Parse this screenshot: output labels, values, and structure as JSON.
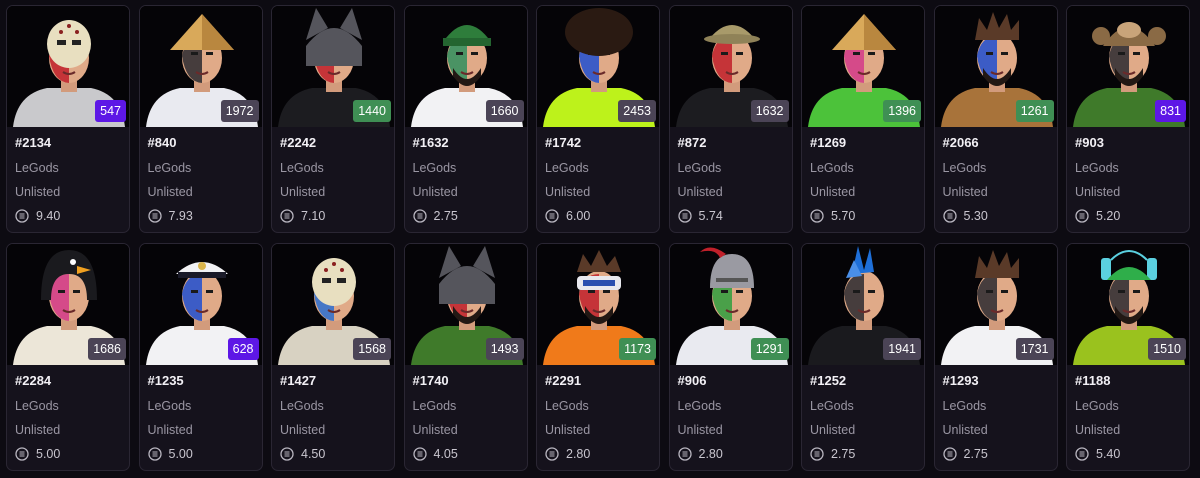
{
  "currency_icon": "solana-coin-icon",
  "rank_colors": {
    "purple": "#5d17e6",
    "gray": "#4b4456",
    "green": "#3f8f54"
  },
  "cards": [
    {
      "token": "#2134",
      "collection": "LeGods",
      "status": "Unlisted",
      "price": "9.40",
      "rank": "547",
      "rank_color": "#5d17e6",
      "outfit": "#c9c9cc",
      "hat": "hockey-mask",
      "hat_color": "#e8dfc0",
      "paint": "#c0202a",
      "has_beard": false
    },
    {
      "token": "#840",
      "collection": "LeGods",
      "status": "Unlisted",
      "price": "7.93",
      "rank": "1972",
      "rank_color": "#4b4456",
      "outfit": "#e9eaf0",
      "hat": "conical-hat",
      "hat_color": "#d9a95a",
      "paint": "#2a2a30",
      "has_beard": false
    },
    {
      "token": "#2242",
      "collection": "LeGods",
      "status": "Unlisted",
      "price": "7.10",
      "rank": "1440",
      "rank_color": "#3f8f54",
      "outfit": "#1c1c20",
      "hat": "wolf-hood",
      "hat_color": "#55555c",
      "paint": "#c0202a",
      "has_beard": false
    },
    {
      "token": "#1632",
      "collection": "LeGods",
      "status": "Unlisted",
      "price": "2.75",
      "rank": "1660",
      "rank_color": "#4b4456",
      "outfit": "#f2f2f4",
      "hat": "beanie",
      "hat_color": "#2e7d3b",
      "paint": "#2f8f5e",
      "has_beard": true
    },
    {
      "token": "#1742",
      "collection": "LeGods",
      "status": "Unlisted",
      "price": "6.00",
      "rank": "2453",
      "rank_color": "#4b4456",
      "outfit": "#bdf21b",
      "hat": "afro",
      "hat_color": "#2a1a12",
      "paint": "#1e4fd1",
      "has_beard": false
    },
    {
      "token": "#872",
      "collection": "LeGods",
      "status": "Unlisted",
      "price": "5.74",
      "rank": "1632",
      "rank_color": "#4b4456",
      "outfit": "#1c1c20",
      "hat": "bucket-hat",
      "hat_color": "#a89a6a",
      "paint": "#c0202a",
      "has_beard": false
    },
    {
      "token": "#1269",
      "collection": "LeGods",
      "status": "Unlisted",
      "price": "5.70",
      "rank": "1396",
      "rank_color": "#3f8f54",
      "outfit": "#4cc23a",
      "hat": "conical-hat",
      "hat_color": "#d9a95a",
      "paint": "#d23a8a",
      "has_beard": false
    },
    {
      "token": "#2066",
      "collection": "LeGods",
      "status": "Unlisted",
      "price": "5.30",
      "rank": "1261",
      "rank_color": "#3f8f54",
      "outfit": "#a8733a",
      "hat": "spiky-hair",
      "hat_color": "#5a3a28",
      "paint": "#1e4fd1",
      "has_beard": true
    },
    {
      "token": "#903",
      "collection": "LeGods",
      "status": "Unlisted",
      "price": "5.20",
      "rank": "831",
      "rank_color": "#5d17e6",
      "outfit": "#3f7a2a",
      "hat": "monkey-hood",
      "hat_color": "#8a6a45",
      "paint": "#2a2a30",
      "has_beard": true
    },
    {
      "token": "#2284",
      "collection": "LeGods",
      "status": "Unlisted",
      "price": "5.00",
      "rank": "1686",
      "rank_color": "#4b4456",
      "outfit": "#ece6d8",
      "hat": "penguin-hood",
      "hat_color": "#1a1a1e",
      "paint": "#d23a8a",
      "has_beard": false
    },
    {
      "token": "#1235",
      "collection": "LeGods",
      "status": "Unlisted",
      "price": "5.00",
      "rank": "628",
      "rank_color": "#5d17e6",
      "outfit": "#f2f2f4",
      "hat": "captain-hat",
      "hat_color": "#f2f2f4",
      "paint": "#1e4fd1",
      "has_beard": false
    },
    {
      "token": "#1427",
      "collection": "LeGods",
      "status": "Unlisted",
      "price": "4.50",
      "rank": "1568",
      "rank_color": "#4b4456",
      "outfit": "#d8d2c2",
      "hat": "hockey-mask",
      "hat_color": "#e8dfc0",
      "paint": "#2a6fd1",
      "has_beard": false
    },
    {
      "token": "#1740",
      "collection": "LeGods",
      "status": "Unlisted",
      "price": "4.05",
      "rank": "1493",
      "rank_color": "#4b4456",
      "outfit": "#3f7a2a",
      "hat": "wolf-hood",
      "hat_color": "#55555c",
      "paint": "#c0202a",
      "has_beard": true
    },
    {
      "token": "#2291",
      "collection": "LeGods",
      "status": "Unlisted",
      "price": "2.80",
      "rank": "1173",
      "rank_color": "#3f8f54",
      "outfit": "#f07a1a",
      "hat": "vr-headset",
      "hat_color": "#e8e8ee",
      "paint": "#c0202a",
      "has_beard": true
    },
    {
      "token": "#906",
      "collection": "LeGods",
      "status": "Unlisted",
      "price": "2.80",
      "rank": "1291",
      "rank_color": "#3f8f54",
      "outfit": "#e9eaf0",
      "hat": "knight-helmet",
      "hat_color": "#9a9aa2",
      "paint": "#2f9f3e",
      "has_beard": false
    },
    {
      "token": "#1252",
      "collection": "LeGods",
      "status": "Unlisted",
      "price": "2.75",
      "rank": "1941",
      "rank_color": "#4b4456",
      "outfit": "#1a1a1e",
      "hat": "mohawk",
      "hat_color": "#1e6fd8",
      "paint": "#2a2a30",
      "has_beard": false
    },
    {
      "token": "#1293",
      "collection": "LeGods",
      "status": "Unlisted",
      "price": "2.75",
      "rank": "1731",
      "rank_color": "#4b4456",
      "outfit": "#f2f2f4",
      "hat": "spiky-hair",
      "hat_color": "#5a3a28",
      "paint": "#2a2a30",
      "has_beard": false
    },
    {
      "token": "#1188",
      "collection": "LeGods",
      "status": "Unlisted",
      "price": "5.40",
      "rank": "1510",
      "rank_color": "#4b4456",
      "outfit": "#9ac21e",
      "hat": "drink-helmet",
      "hat_color": "#2fae4a",
      "paint": "#2a2a30",
      "has_beard": true
    }
  ]
}
